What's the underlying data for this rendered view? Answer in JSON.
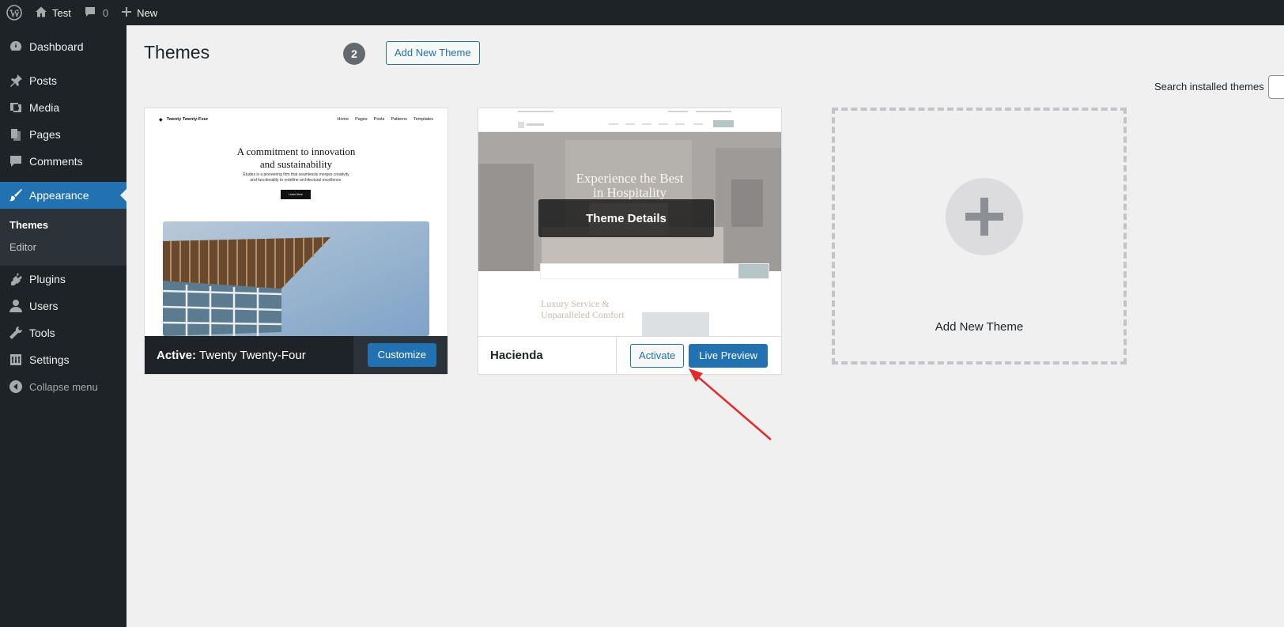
{
  "adminbar": {
    "site_name": "Test",
    "comments_count": "0",
    "new_label": "New"
  },
  "sidebar": {
    "items": [
      {
        "label": "Dashboard",
        "icon": "dashboard-icon"
      },
      {
        "label": "Posts",
        "icon": "pin-icon"
      },
      {
        "label": "Media",
        "icon": "media-icon"
      },
      {
        "label": "Pages",
        "icon": "pages-icon"
      },
      {
        "label": "Comments",
        "icon": "comment-icon"
      },
      {
        "label": "Appearance",
        "icon": "brush-icon",
        "current": true
      },
      {
        "label": "Plugins",
        "icon": "plugin-icon"
      },
      {
        "label": "Users",
        "icon": "user-icon"
      },
      {
        "label": "Tools",
        "icon": "wrench-icon"
      },
      {
        "label": "Settings",
        "icon": "settings-icon"
      }
    ],
    "submenu": [
      "Themes",
      "Editor"
    ],
    "collapse_label": "Collapse menu"
  },
  "page": {
    "title": "Themes",
    "count": "2",
    "add_new_label": "Add New Theme",
    "search_label": "Search installed themes"
  },
  "themes": [
    {
      "active_prefix": "Active:",
      "name": "Twenty Twenty-Four",
      "action_label": "Customize",
      "preview": {
        "brand": "Twenty Twenty-Four",
        "nav": [
          "Home",
          "Pages",
          "Posts",
          "Patterns",
          "Templates"
        ],
        "headline_1": "A commitment to innovation",
        "headline_2": "and sustainability",
        "body_1": "Études is a pioneering firm that seamlessly merges creativity",
        "body_2": "and functionality to redefine architectural excellence.",
        "button": "Learn More"
      }
    },
    {
      "name": "Hacienda",
      "details_label": "Theme Details",
      "activate_label": "Activate",
      "preview_label": "Live Preview",
      "preview": {
        "hero_1": "Experience the Best",
        "hero_2": "in Hospitality",
        "lower_1": "Luxury Service &",
        "lower_2": "Unparalleled Comfort"
      }
    }
  ],
  "add_new_tile": {
    "label": "Add New Theme"
  },
  "colors": {
    "admin_dark": "#1d2327",
    "accent": "#2271b1",
    "background": "#f0f0f1",
    "arrow": "#e32a2a"
  }
}
